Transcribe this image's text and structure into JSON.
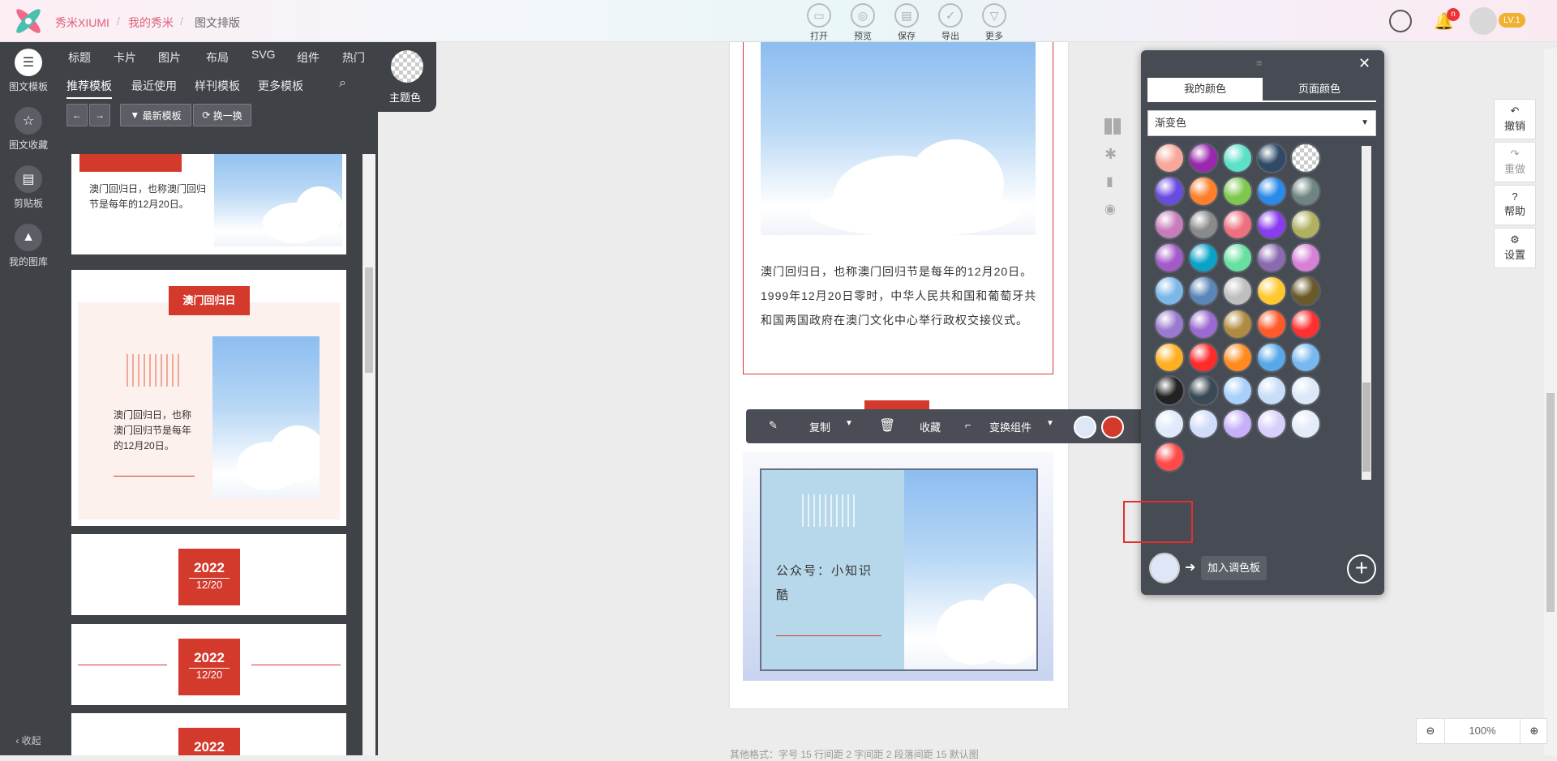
{
  "header": {
    "brand": "秀米XIUMI",
    "breadcrumb": [
      "我的秀米",
      "图文排版"
    ],
    "tools": [
      {
        "label": "打开",
        "icon": "folder-icon"
      },
      {
        "label": "预览",
        "icon": "preview-icon"
      },
      {
        "label": "保存",
        "icon": "save-icon"
      },
      {
        "label": "导出",
        "icon": "export-icon"
      },
      {
        "label": "更多",
        "icon": "more-icon"
      }
    ],
    "notification_count": "n",
    "level": "LV.1"
  },
  "sidebar": {
    "items": [
      "图文模板",
      "图文收藏",
      "剪贴板",
      "我的图库"
    ],
    "collapse": "收起"
  },
  "template_panel": {
    "categories": [
      "标题",
      "卡片",
      "图片",
      "布局",
      "SVG",
      "组件",
      "热门"
    ],
    "subtabs": [
      "推荐模板",
      "最近使用",
      "样刊模板",
      "更多模板"
    ],
    "btn_newest": "最新模板",
    "btn_switch": "换一换",
    "theme_label": "主题色",
    "card1_text": "澳门回归日，也称澳门回归节是每年的12月20日。",
    "card2_tag": "澳门回归日",
    "card2_text": "澳门回归日，也称澳门回归节是每年的12月20日。",
    "card3_year": "2022",
    "card3_date": "12/20",
    "card4_year": "2022",
    "card4_date": "12/20",
    "card5_year": "2022"
  },
  "canvas": {
    "article_text": "澳门回归日，也称澳门回归节是每年的12月20日。1999年12月20日零时，中华人民共和国和葡萄牙共和国两国政府在澳门文化中心举行政权交接仪式。",
    "card_text": "公众号：小知识酷",
    "footer_info": "其他格式：字号 15   行间距 2   字间距 2   段落间距 15   默认图"
  },
  "component_toolbar": {
    "copy": "复制",
    "favorite": "收藏",
    "transform": "变换组件"
  },
  "palette": {
    "tab_mine": "我的颜色",
    "tab_page": "页面颜色",
    "dropdown_value": "渐变色",
    "add_label": "加入调色板",
    "swatches": [
      [
        "#f7a89a",
        "#9b27b0",
        "#5de0c8",
        "#2e4a66",
        "checker"
      ],
      [
        "#6a4be0",
        "#ff7f2a",
        "#7ec850",
        "#2a8ae8",
        "#6f8582"
      ],
      [
        "#c77dbb",
        "#8a8a8a",
        "#ee6f7d",
        "#8a3cf0",
        "#b0b060"
      ],
      [
        "#a45ac8",
        "#0aa3c8",
        "#68e0a0",
        "#8a6ab0",
        "#d680d6"
      ],
      [
        "#7bb8e8",
        "#5a86b8",
        "#bfbfbf",
        "#ffc830",
        "#6a5a2a"
      ],
      [
        "#9a7ad0",
        "#9a6ad0",
        "#b08a40",
        "#ff5a2a",
        "#ff3030"
      ],
      [
        "#ffb020",
        "#ff2a2a",
        "#ff8a20",
        "#58a8e8",
        "#78b8f0"
      ],
      [
        "#222222",
        "#3a4a55",
        "#a8d0f8",
        "#c8ddf8",
        "#dce8f8"
      ],
      [
        "#e0eafa",
        "#d0dcfa",
        "#c8b0f8",
        "#d8d0fa",
        "#e4ecf8"
      ],
      [
        "#ff4a4a"
      ]
    ]
  },
  "right_panel": {
    "undo": "撤销",
    "redo": "重做",
    "help": "帮助",
    "settings": "设置"
  },
  "zoom": {
    "value": "100%"
  }
}
